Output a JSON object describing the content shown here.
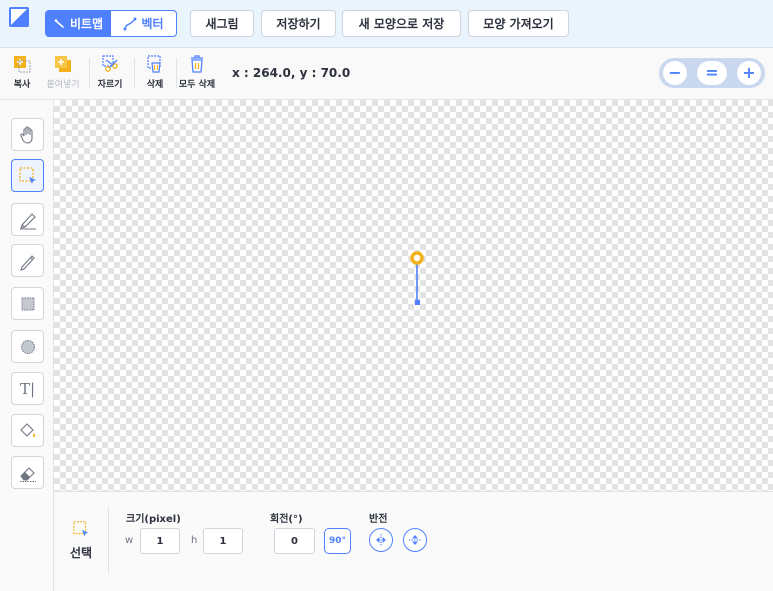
{
  "mode_toggle": {
    "bitmap_label": "비트맵",
    "vector_label": "벡터"
  },
  "top_actions": {
    "new_drawing": "새그림",
    "save": "저장하기",
    "save_as_new_shape": "새 모양으로 저장",
    "import_shape": "모양 가져오기"
  },
  "edit_tools": {
    "copy": "복사",
    "paste": "붙여넣기",
    "cut": "자르기",
    "delete": "삭제",
    "delete_all": "모두 삭제"
  },
  "cursor_coords": "x : 264.0, y : 70.0",
  "zoom": {
    "zoom_out": "−",
    "reset": "=",
    "zoom_in": "+"
  },
  "tools": [
    "hand",
    "select",
    "brush",
    "pencil",
    "rectangle",
    "ellipse",
    "text",
    "fill",
    "eraser"
  ],
  "selected_tool": "select",
  "text_tool_glyph": "T|",
  "selection_panel": {
    "tool_label": "선택",
    "size_title": "크기(pixel)",
    "width_label": "w",
    "width_value": "1",
    "height_label": "h",
    "height_value": "1",
    "rotation_title": "회전(°)",
    "rotation_value": "0",
    "rotate_90_label": "90°",
    "flip_title": "반전"
  },
  "colors": {
    "accent": "#4f80ff",
    "handle": "#f3b21b",
    "topbar_bg": "#eaf4fc"
  }
}
